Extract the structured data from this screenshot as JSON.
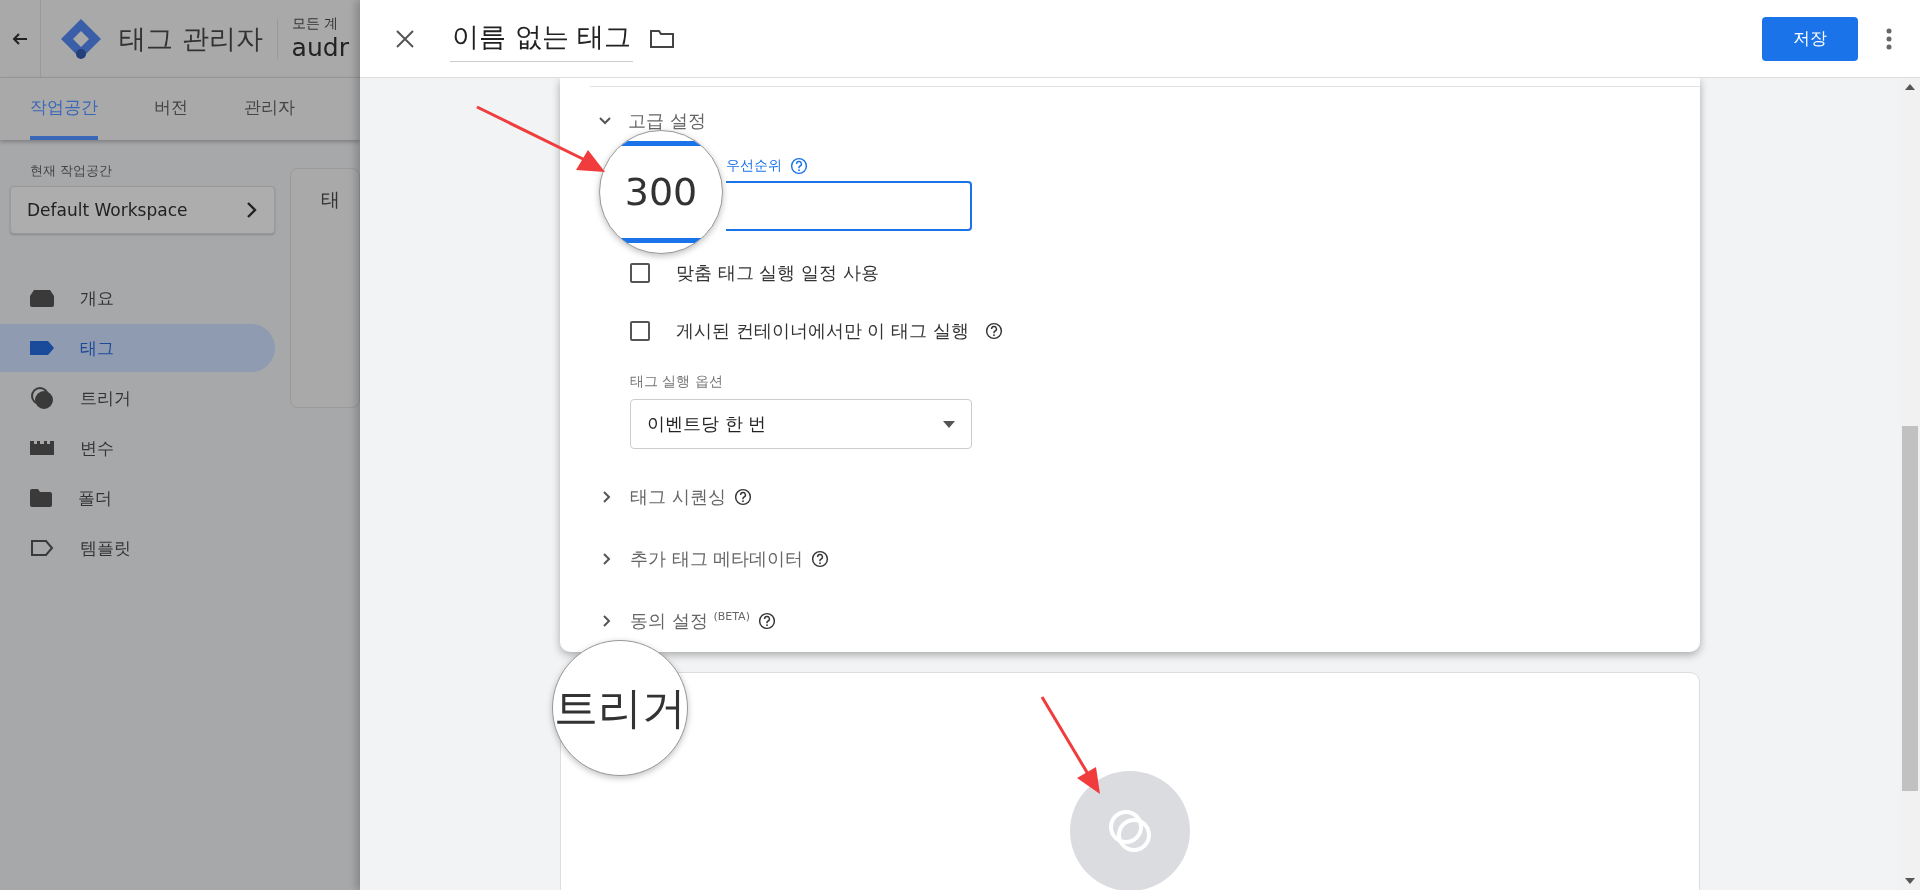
{
  "background_app": {
    "title": "태그 관리자",
    "account_label": "모든 계",
    "container_name": "audr",
    "tabs": [
      {
        "label": "작업공간",
        "selected": true
      },
      {
        "label": "버전",
        "selected": false
      },
      {
        "label": "관리자",
        "selected": false
      }
    ],
    "workspace_label": "현재 작업공간",
    "workspace": "Default Workspace",
    "nav": [
      {
        "label": "개요",
        "kind": "overview",
        "selected": false
      },
      {
        "label": "태그",
        "kind": "tag",
        "selected": true
      },
      {
        "label": "트리거",
        "kind": "trigger",
        "selected": false
      },
      {
        "label": "변수",
        "kind": "variable",
        "selected": false
      },
      {
        "label": "폴더",
        "kind": "folder",
        "selected": false
      },
      {
        "label": "템플릿",
        "kind": "template",
        "selected": false
      }
    ],
    "card_title": "태"
  },
  "panel": {
    "title": "이름 없는 태그",
    "save": "저장",
    "advanced": {
      "label": "고급 설정",
      "expanded": true
    },
    "priority": {
      "label": "우선순위",
      "help": true
    },
    "checkboxes": [
      {
        "label": "맞춤 태그 실행 일정 사용",
        "checked": false,
        "help": false
      },
      {
        "label": "게시된 컨테이너에서만 이 태그 실행",
        "checked": false,
        "help": true
      }
    ],
    "firing_option": {
      "label": "태그 실행 옵션",
      "value": "이벤트당 한 번"
    },
    "sections": [
      {
        "label": "태그 시퀀싱",
        "expanded": false
      },
      {
        "label": "추가 태그 메타데이터",
        "expanded": false
      },
      {
        "label": "동의 설정 $^{(BETA)}$",
        "expanded": false
      }
    ]
  },
  "annotations": {
    "magnifiers": [
      {
        "text": "300",
        "kind": "field"
      },
      {
        "text": "트리거",
        "kind": "plain"
      }
    ]
  }
}
